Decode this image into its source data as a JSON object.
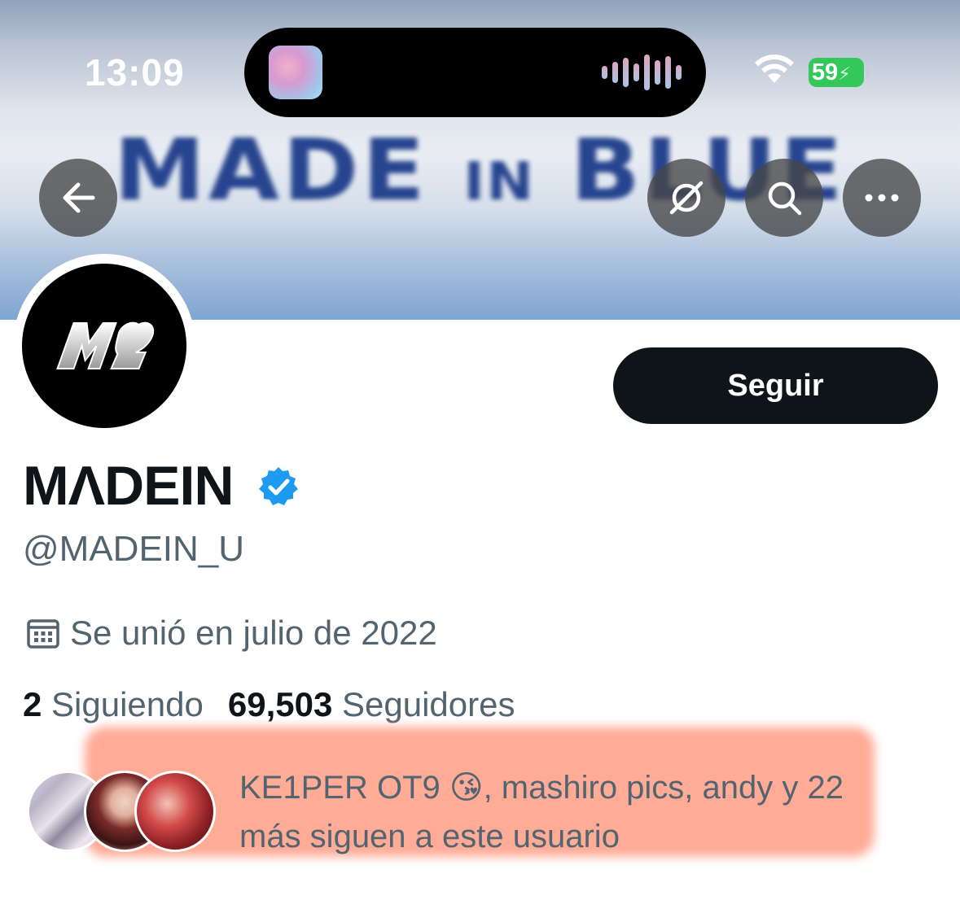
{
  "status_bar": {
    "time": "13:09",
    "battery": "59",
    "battery_color": "#34c759"
  },
  "banner": {
    "title_main": "MADE",
    "title_small": "IN",
    "title_end": "BLUE",
    "accent_color": "#1d3c8a"
  },
  "header": {
    "back_icon": "arrow-left-icon",
    "grok_icon": "slashed-circle-icon",
    "search_icon": "search-icon",
    "more_icon": "more-icon"
  },
  "profile": {
    "avatar_logo": "M♡",
    "follow_label": "Seguir",
    "display_name": "MΛDEIN",
    "verified": true,
    "verified_color": "#1d9bf0",
    "handle": "@MADEIN_U",
    "joined": "Se unió en julio de 2022",
    "following_count": "2",
    "following_label": "Siguiendo",
    "followers_count": "69,503",
    "followers_label": "Seguidores",
    "followed_by_text": "KE1PER OT9 😘, mashiro pics, andy y 22 más siguen a este usuario",
    "highlight_color": "#ffab96"
  }
}
